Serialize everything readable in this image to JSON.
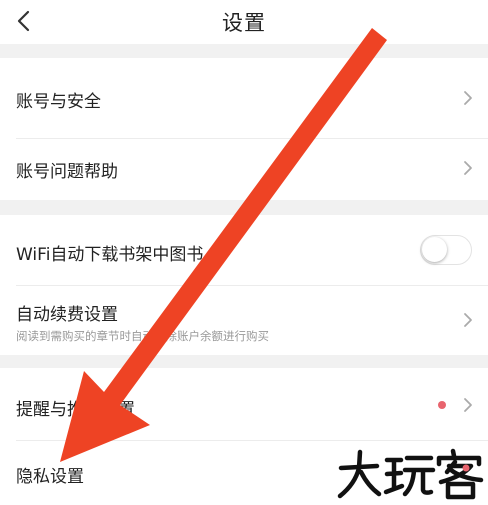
{
  "header": {
    "title": "设置"
  },
  "groups": [
    {
      "items": [
        {
          "label": "账号与安全"
        },
        {
          "label": "账号问题帮助"
        }
      ]
    },
    {
      "items": [
        {
          "label": "WiFi自动下载书架中图书",
          "toggle_on": false
        },
        {
          "label": "自动续费设置",
          "sub": "阅读到需购买的章节时自动扣除账户余额进行购买"
        }
      ]
    },
    {
      "items": [
        {
          "label": "提醒与推送设置",
          "has_dot": true
        },
        {
          "label": "隐私设置"
        }
      ]
    }
  ],
  "watermark": {
    "text": "大玩客"
  },
  "colors": {
    "arrow": "#ee4324",
    "dot": "#e8646e",
    "background": "#f1f1f1"
  }
}
